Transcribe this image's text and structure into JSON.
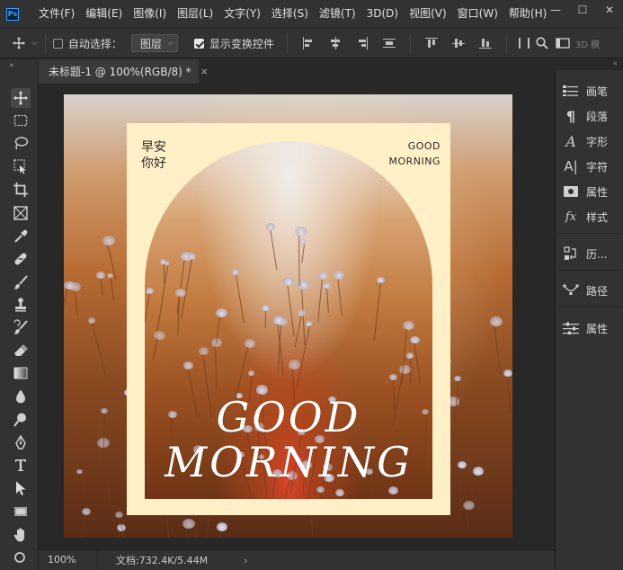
{
  "app": {
    "logo": "Ps"
  },
  "menu": {
    "items": [
      "文件(F)",
      "编辑(E)",
      "图像(I)",
      "图层(L)",
      "文字(Y)",
      "选择(S)",
      "滤镜(T)",
      "3D(D)",
      "视图(V)",
      "窗口(W)",
      "帮助(H)"
    ]
  },
  "window_controls": {
    "minimize": "—",
    "maximize": "☐",
    "close": "✕"
  },
  "options": {
    "auto_select_label": "自动选择：",
    "auto_select_checked": false,
    "layer_dropdown": "图层",
    "show_transform_label": "显示变换控件",
    "show_transform_checked": true,
    "mode_3d_label": "3D 模"
  },
  "document": {
    "tab_title": "未标题-1 @ 100%(RGB/8) *",
    "close": "×"
  },
  "artwork": {
    "greeting_cn_line1": "早安",
    "greeting_cn_line2": "你好",
    "greeting_en_line1": "GOOD",
    "greeting_en_line2": "MORNING",
    "title_line1": "GOOD",
    "title_line2": "MORNING",
    "card_color": "#fff0c8"
  },
  "panels": {
    "items": [
      {
        "icon": "brush-panel-icon",
        "label": "画笔"
      },
      {
        "icon": "paragraph-icon",
        "label": "段落"
      },
      {
        "icon": "glyph-icon",
        "label": "字形"
      },
      {
        "icon": "character-icon",
        "label": "字符"
      },
      {
        "icon": "properties-icon",
        "label": "属性"
      },
      {
        "icon": "styles-icon",
        "label": "样式"
      },
      {
        "icon": "history-icon",
        "label": "历..."
      },
      {
        "icon": "paths-icon",
        "label": "路径"
      },
      {
        "icon": "adjustments-icon",
        "label": "属性"
      }
    ]
  },
  "status": {
    "zoom": "100%",
    "doc_info": "文档:732.4K/5.44M",
    "arrow": "›"
  },
  "tools": [
    "move-tool",
    "marquee-tool",
    "lasso-tool",
    "object-select-tool",
    "crop-tool",
    "frame-tool",
    "eyedropper-tool",
    "healing-brush-tool",
    "brush-tool",
    "clone-stamp-tool",
    "history-brush-tool",
    "eraser-tool",
    "gradient-tool",
    "blur-tool",
    "dodge-tool",
    "pen-tool",
    "type-tool",
    "path-select-tool",
    "rectangle-tool",
    "hand-tool",
    "zoom-tool"
  ]
}
